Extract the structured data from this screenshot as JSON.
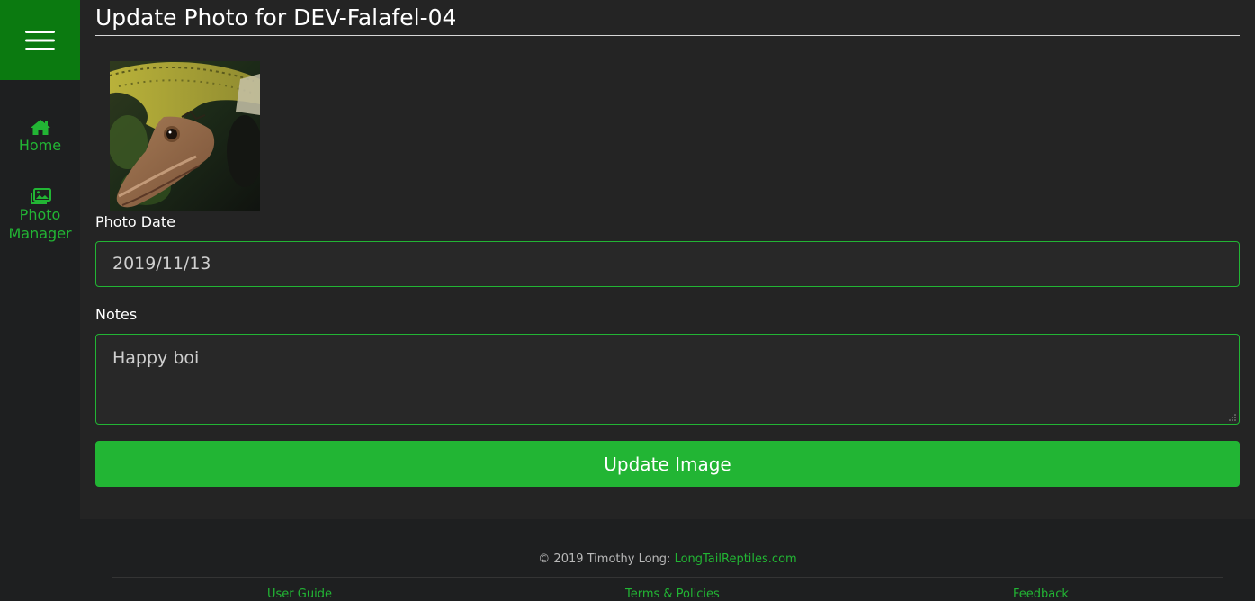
{
  "sidebar": {
    "menu_icon": "hamburger-icon",
    "items": [
      {
        "label": "Home",
        "icon": "home-icon"
      },
      {
        "label": "Photo Manager",
        "icon": "images-icon"
      }
    ],
    "accent_color": "#22b534",
    "header_color": "#0b7a10"
  },
  "page": {
    "title": "Update Photo for DEV-Falafel-04"
  },
  "form": {
    "photo_date_label": "Photo Date",
    "photo_date_value": "2019/11/13",
    "notes_label": "Notes",
    "notes_value": "Happy boi",
    "submit_label": "Update Image"
  },
  "footer": {
    "copyright": "© 2019 Timothy Long: ",
    "site_link": "LongTailReptiles.com",
    "links": [
      "User Guide",
      "Terms & Policies",
      "Feedback"
    ]
  }
}
